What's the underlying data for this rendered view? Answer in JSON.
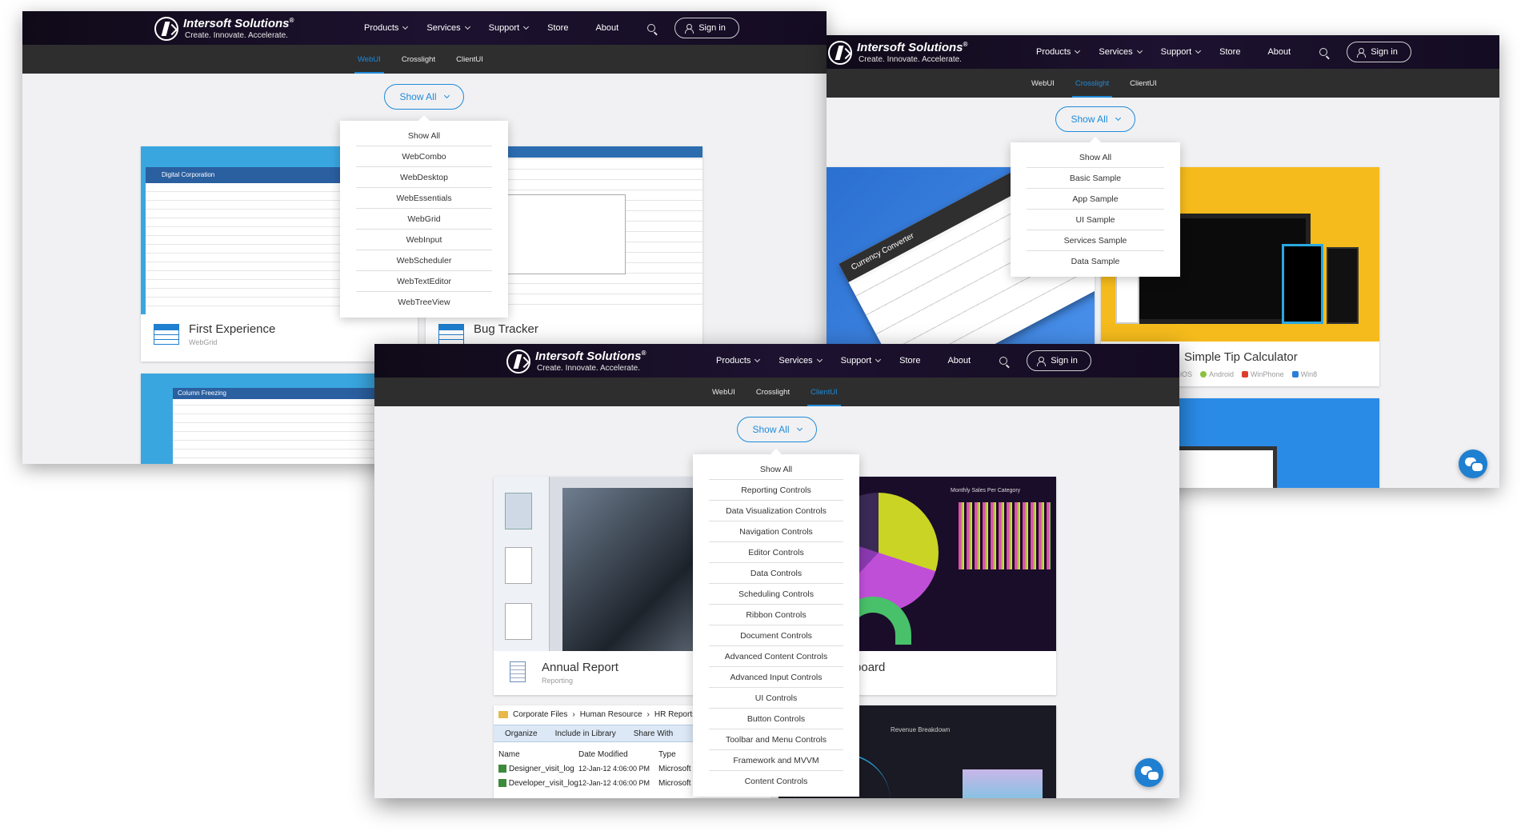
{
  "brand": {
    "name": "Intersoft Solutions",
    "reg": "®",
    "tagline": "Create. Innovate. Accelerate."
  },
  "nav": {
    "products": "Products",
    "services": "Services",
    "support": "Support",
    "store": "Store",
    "about": "About",
    "signin": "Sign in"
  },
  "tabs": {
    "webui": "WebUI",
    "crosslight": "Crosslight",
    "clientui": "ClientUI"
  },
  "show_all": "Show All",
  "webui_window": {
    "dropdown": [
      "Show All",
      "WebCombo",
      "WebDesktop",
      "WebEssentials",
      "WebGrid",
      "WebInput",
      "WebScheduler",
      "WebTextEditor",
      "WebTreeView"
    ],
    "cards": [
      {
        "title": "First Experience",
        "subtitle": "WebGrid",
        "thumb_label": "Digital Corporation"
      },
      {
        "title": "Bug Tracker"
      },
      {
        "thumb_label": "Column Freezing"
      }
    ]
  },
  "crosslight_window": {
    "dropdown": [
      "Show All",
      "Basic Sample",
      "App Sample",
      "UI Sample",
      "Services Sample",
      "Data Sample"
    ],
    "cards": [
      {
        "thumb_label": "Currency Converter"
      },
      {
        "title": "Simple Tip Calculator",
        "platforms": [
          "iOS",
          "Android",
          "WinPhone",
          "Win8"
        ]
      }
    ]
  },
  "clientui_window": {
    "dropdown": [
      "Show All",
      "Reporting Controls",
      "Data Visualization Controls",
      "Navigation Controls",
      "Editor Controls",
      "Data Controls",
      "Scheduling Controls",
      "Ribbon Controls",
      "Document Controls",
      "Advanced Content Controls",
      "Advanced Input Controls",
      "UI Controls",
      "Button Controls",
      "Toolbar and Menu Controls",
      "Framework and MVVM",
      "Content Controls"
    ],
    "cards": [
      {
        "title": "Annual Report",
        "subtitle": "Reporting"
      },
      {
        "title": "Dashboard",
        "thumb_label": "Monthly Sales Per Category"
      }
    ],
    "explorer": {
      "breadcrumb": [
        "Corporate Files",
        "Human Resource",
        "HR Reports"
      ],
      "toolbar": [
        "Organize",
        "Include in Library",
        "Share With"
      ],
      "columns": [
        "Name",
        "Date Modified",
        "Type"
      ],
      "rows": [
        {
          "name": "Designer_visit_log",
          "date": "12-Jan-12 4:06:00 PM",
          "type": "Microsoft"
        },
        {
          "name": "Developer_visit_log",
          "date": "12-Jan-12 4:06:00 PM",
          "type": "Microsoft"
        }
      ]
    },
    "revenue_label": "Revenue Breakdown"
  },
  "colors": {
    "accent": "#1f8ad9",
    "header": "#1d1230",
    "subnav": "#2e2e2e"
  }
}
